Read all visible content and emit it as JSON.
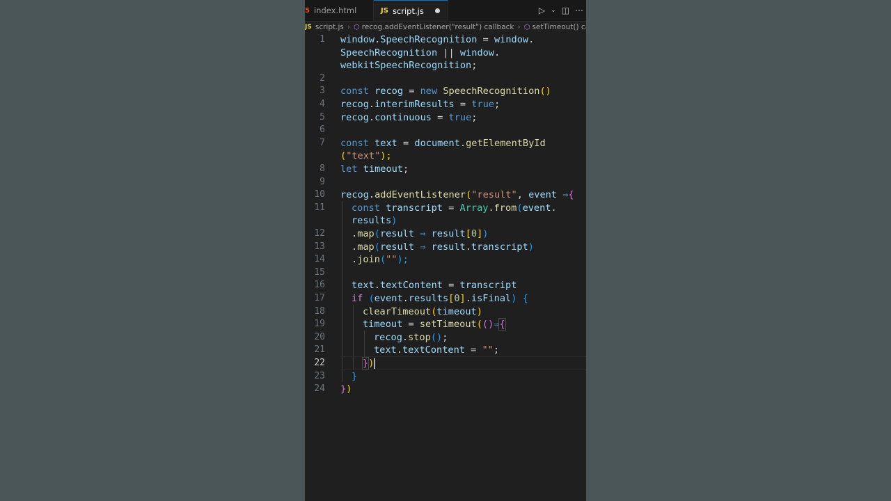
{
  "tabs": [
    {
      "label": "index.html",
      "icon": "html5-icon",
      "active": false
    },
    {
      "label": "script.js",
      "icon": "js-file-icon",
      "active": true,
      "unsaved": true
    }
  ],
  "breadcrumb": [
    "script.js",
    "recog.addEventListener(\"result\") callback",
    "setTimeout() callback"
  ],
  "icon_labels": {
    "js": "JS",
    "html": "5"
  },
  "line_numbers": [
    "1",
    "2",
    "3",
    "4",
    "5",
    "6",
    "7",
    "8",
    "9",
    "10",
    "11",
    "12",
    "13",
    "14",
    "15",
    "16",
    "17",
    "18",
    "19",
    "20",
    "21",
    "22",
    "23",
    "24"
  ],
  "code": {
    "l1a": [
      "window",
      ".",
      "SpeechRecognition",
      " = ",
      "window",
      "."
    ],
    "l1b": [
      "SpeechRecognition",
      " || ",
      "window",
      "."
    ],
    "l1c": [
      "webkitSpeechRecognition",
      ";"
    ],
    "l3": [
      "const",
      " ",
      "recog",
      " = ",
      "new",
      " ",
      "SpeechRecognition",
      "()"
    ],
    "l4": [
      "recog",
      ".",
      "interimResults",
      " = ",
      "true",
      ";"
    ],
    "l5": [
      "recog",
      ".",
      "continuous",
      " = ",
      "true",
      ";"
    ],
    "l7a": [
      "const",
      " ",
      "text",
      " = ",
      "document",
      ".",
      "getElementById"
    ],
    "l7b": [
      "(",
      "\"text\"",
      ");"
    ],
    "l8": [
      "let",
      " ",
      "timeout",
      ";"
    ],
    "l10": [
      "recog",
      ".",
      "addEventListener",
      "(",
      "\"result\"",
      ", ",
      "event",
      " ⇒",
      "{"
    ],
    "l11a": [
      "const",
      " ",
      "transcript",
      " = ",
      "Array",
      ".",
      "from",
      "(",
      "event",
      "."
    ],
    "l11b": [
      "results",
      ")"
    ],
    "l12": [
      ".",
      "map",
      "(",
      "result",
      " ⇒ ",
      "result",
      "[",
      "0",
      "]",
      ")"
    ],
    "l13": [
      ".",
      "map",
      "(",
      "result",
      " ⇒ ",
      "result",
      ".",
      "transcript",
      ")"
    ],
    "l14": [
      ".",
      "join",
      "(",
      "\"\"",
      ");"
    ],
    "l16": [
      "text",
      ".",
      "textContent",
      " = ",
      "transcript"
    ],
    "l17": [
      "if",
      " ",
      "(",
      "event",
      ".",
      "results",
      "[",
      "0",
      "]",
      ".",
      "isFinal",
      ")",
      " ",
      "{"
    ],
    "l18": [
      "clearTimeout",
      "(",
      "timeout",
      ")"
    ],
    "l19": [
      "timeout",
      " = ",
      "setTimeout",
      "(",
      "()",
      "⇒",
      "{"
    ],
    "l20": [
      "recog",
      ".",
      "stop",
      "()",
      ";"
    ],
    "l21": [
      "text",
      ".",
      "textContent",
      " = ",
      "\"\"",
      ";"
    ],
    "l22": [
      "}",
      ")"
    ],
    "l23": [
      "}"
    ],
    "l24": [
      "}",
      ")"
    ]
  }
}
